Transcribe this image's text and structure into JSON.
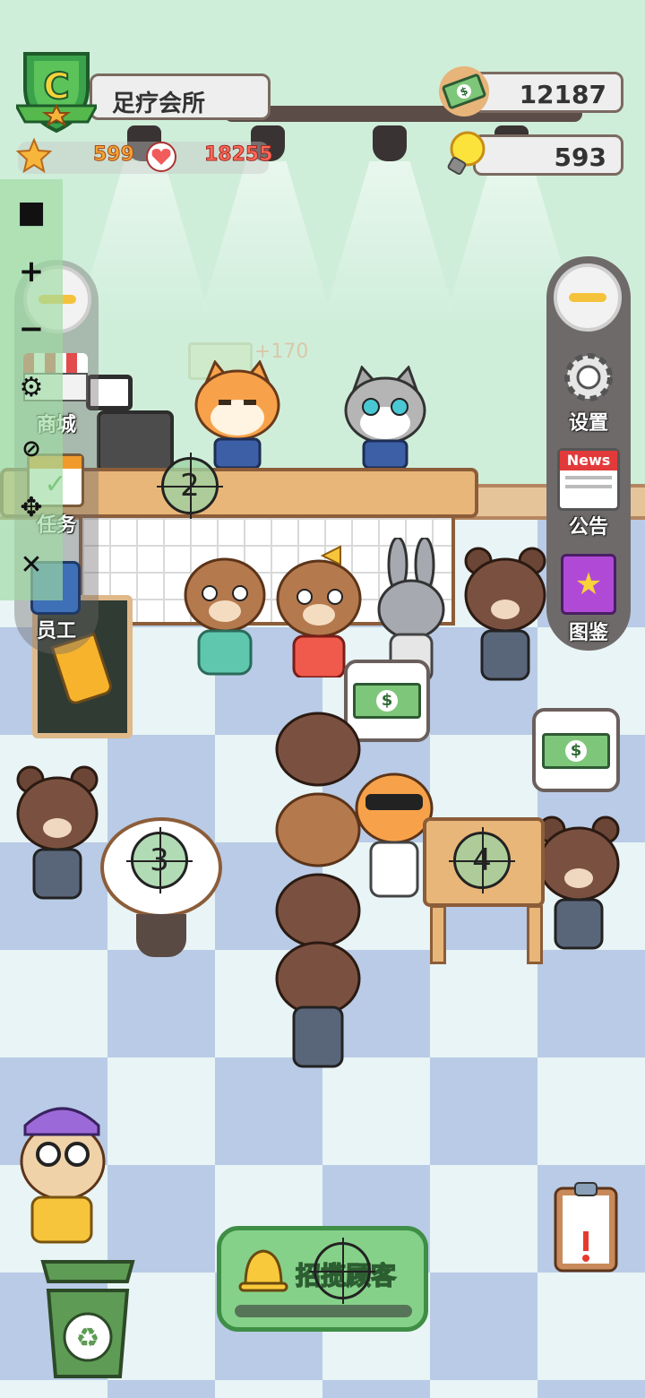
{
  "header": {
    "shop_name": "足疗会所",
    "badge_letter": "C",
    "money": "12187",
    "bulbs": "593",
    "stars": "599",
    "hearts": "18255"
  },
  "left_menu": [
    {
      "label": "商城",
      "icon": "shop-icon"
    },
    {
      "label": "任务",
      "icon": "task-icon"
    },
    {
      "label": "员工",
      "icon": "staff-icon"
    }
  ],
  "right_menu": [
    {
      "label": "设置",
      "icon": "gear-icon"
    },
    {
      "label": "公告",
      "icon": "news-icon"
    },
    {
      "label": "图鉴",
      "icon": "collection-icon"
    }
  ],
  "news_label": "News",
  "ghost_reward": "+170",
  "crosshairs": {
    "counter": "2",
    "table_left": "3",
    "table_right": "4"
  },
  "bottom": {
    "call_button": "招揽顾客"
  },
  "debug_icons": [
    "■",
    "+",
    "−"
  ],
  "colors": {
    "accent_green": "#86d18a",
    "wood": "#e8b679",
    "floor_blue": "#b9cbe6"
  }
}
